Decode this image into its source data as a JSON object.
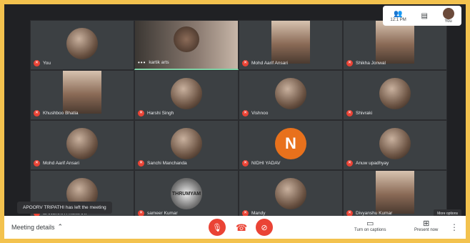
{
  "participants": [
    {
      "name": "You",
      "kind": "avatar"
    },
    {
      "name": "kartik arts",
      "kind": "video",
      "active": true,
      "menu": "•••"
    },
    {
      "name": "Mohd Aarif Ansari",
      "kind": "photo"
    },
    {
      "name": "Shikha Jonwal",
      "kind": "photo"
    },
    {
      "name": "Khushboo Bhatia",
      "kind": "photo"
    },
    {
      "name": "Harshi Singh",
      "kind": "avatar"
    },
    {
      "name": "Vishnoo",
      "kind": "avatar"
    },
    {
      "name": "Shivraki",
      "kind": "avatar"
    },
    {
      "name": "Mohd Aarif Ansari",
      "kind": "avatar"
    },
    {
      "name": "Sanchi Manchanda",
      "kind": "avatar"
    },
    {
      "name": "NIDHI YADAV",
      "kind": "letter",
      "letter": "N"
    },
    {
      "name": "Anuw upadhyay",
      "kind": "avatar"
    },
    {
      "name": "SANSKRITI KUMARI",
      "kind": "avatar"
    },
    {
      "name": "sameer Kumar",
      "kind": "logo",
      "logo_text": "THRUMYAM"
    },
    {
      "name": "Mandy",
      "kind": "avatar"
    },
    {
      "name": "Divyanshu Kumar",
      "kind": "photo"
    }
  ],
  "self_view": {
    "label": "You",
    "time_label": "12:1 PM"
  },
  "toast": "APOORV TRIPATHI has left the meeting",
  "more_options": "More options",
  "bottom_bar": {
    "meeting_details": "Meeting details",
    "captions": "Turn on captions",
    "present": "Present now"
  },
  "colors": {
    "background": "#f3c24e",
    "tile": "#3c4043",
    "mic_off": "#ea4335",
    "active_speaker": "#7fd3a6",
    "letter_avatar": "#e8711c"
  }
}
